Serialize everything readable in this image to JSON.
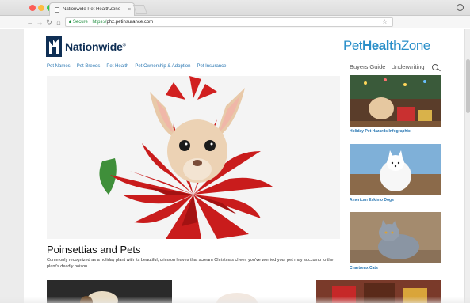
{
  "browser": {
    "tab_title": "Nationwide Pet HealthZone",
    "tab_close": "×",
    "secure_label": "Secure",
    "url_scheme": "https://",
    "url_host": "phz.petinsurance.com",
    "icons": [
      "back-icon",
      "forward-icon",
      "reload-icon",
      "home-icon",
      "lock-icon",
      "star-icon",
      "menu-icon",
      "profile-icon"
    ]
  },
  "brand": {
    "name": "Nationwide",
    "reg": "®",
    "colors": {
      "navy": "#0f2f55",
      "accent": "#2a8fc9"
    }
  },
  "phz": {
    "part1": "Pet",
    "part2": "Health",
    "part3": "Zone"
  },
  "nav": {
    "links": [
      "Pet Names",
      "Pet Breeds",
      "Pet Health",
      "Pet Ownership & Adoption",
      "Pet Insurance"
    ]
  },
  "utility": {
    "buyers_guide": "Buyers Guide",
    "underwriting": "Underwriting"
  },
  "hero": {
    "title": "Poinsettias and Pets",
    "excerpt": "Commonly recognized as a holiday plant with its beautiful, crimson leaves that scream Christmas cheer, you've worried your pet may succumb to the plant's deadly poison. ..."
  },
  "sidebar": {
    "cards": [
      {
        "caption": "Holiday Pet Hazards Infographic"
      },
      {
        "caption": "American Eskimo Dogs"
      },
      {
        "caption": "Chartreux Cats"
      }
    ]
  }
}
